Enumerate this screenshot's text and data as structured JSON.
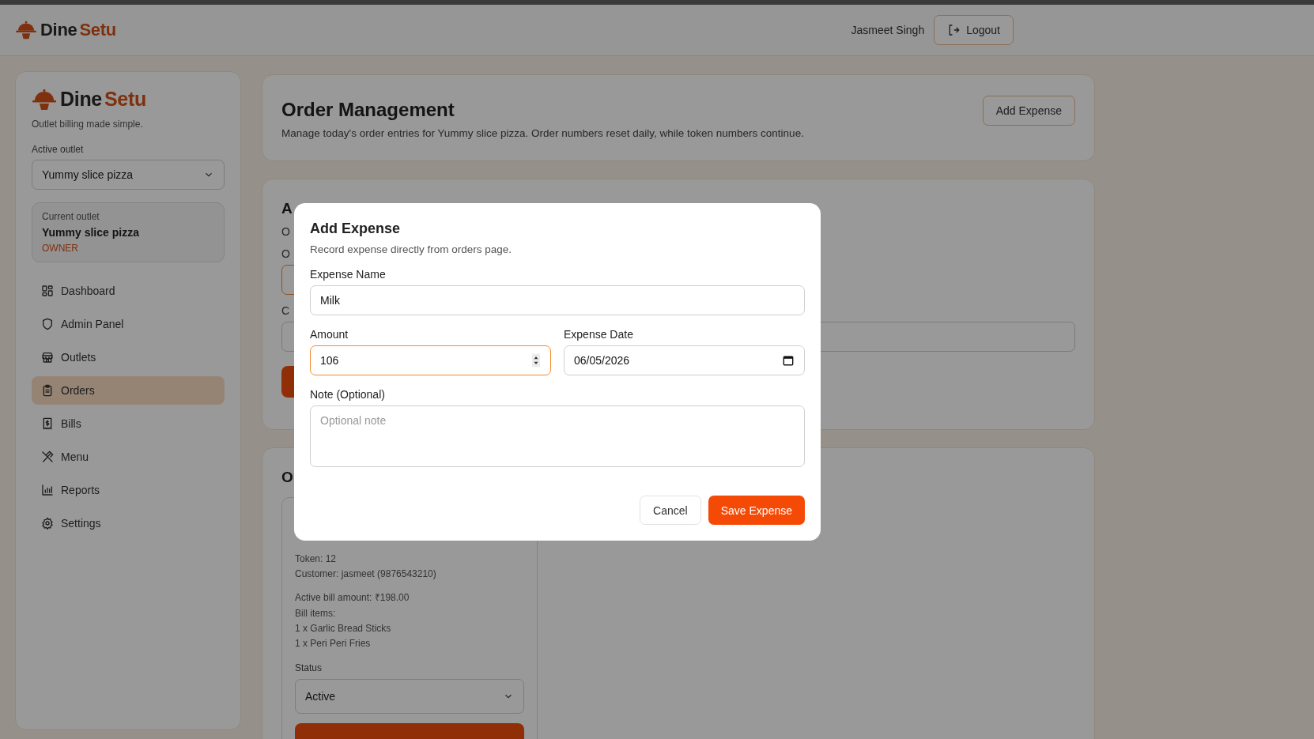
{
  "top_bar": {
    "brand": {
      "first": "Dine",
      "second": "Setu"
    },
    "user_name": "Jasmeet Singh",
    "logout": "Logout"
  },
  "sidebar": {
    "brand": {
      "first": "Dine",
      "second": "Setu"
    },
    "tagline": "Outlet billing made simple.",
    "outlet_label": "Active outlet",
    "outlet_select": "Yummy slice pizza",
    "current_outlet": {
      "label": "Current outlet",
      "name": "Yummy slice pizza",
      "role": "OWNER"
    },
    "nav": [
      {
        "label": "Dashboard",
        "kind": "grid",
        "selected": false
      },
      {
        "label": "Admin Panel",
        "kind": "shield",
        "selected": false
      },
      {
        "label": "Outlets",
        "kind": "store",
        "selected": false
      },
      {
        "label": "Orders",
        "kind": "clipboard",
        "selected": true
      },
      {
        "label": "Bills",
        "kind": "receipt",
        "selected": false
      },
      {
        "label": "Menu",
        "kind": "utensils",
        "selected": false
      },
      {
        "label": "Reports",
        "kind": "chart",
        "selected": false
      },
      {
        "label": "Settings",
        "kind": "gear",
        "selected": false
      }
    ]
  },
  "page_header": {
    "title": "Order Management",
    "description": "Manage today's order entries for Yummy slice pizza. Order numbers reset daily, while token numbers continue.",
    "button": "Add Expense"
  },
  "new_order_card": {
    "title": "A",
    "line": "O",
    "field_label_1": "O",
    "field_label_2": "C"
  },
  "orders_card": {
    "title": "O",
    "order": {
      "lines": [
        "Token: 12",
        "Customer: jasmeet (9876543210)"
      ],
      "bill_lines": [
        "Active bill amount: ₹198.00",
        "Bill items:",
        "1 x Garlic Bread Sticks",
        "1 x Peri Peri Fries"
      ],
      "status_label": "Status",
      "status_value": "Active"
    }
  },
  "modal": {
    "title": "Add Expense",
    "subtitle": "Record expense directly from orders page.",
    "name_label": "Expense Name",
    "name_value": "Milk",
    "amount_label": "Amount",
    "amount_value": "106",
    "amount_focused": true,
    "date_label": "Expense Date",
    "date_value": "06/05/2026",
    "note_label": "Note (Optional)",
    "note_placeholder": "Optional note",
    "cancel": "Cancel",
    "save": "Save Expense"
  }
}
